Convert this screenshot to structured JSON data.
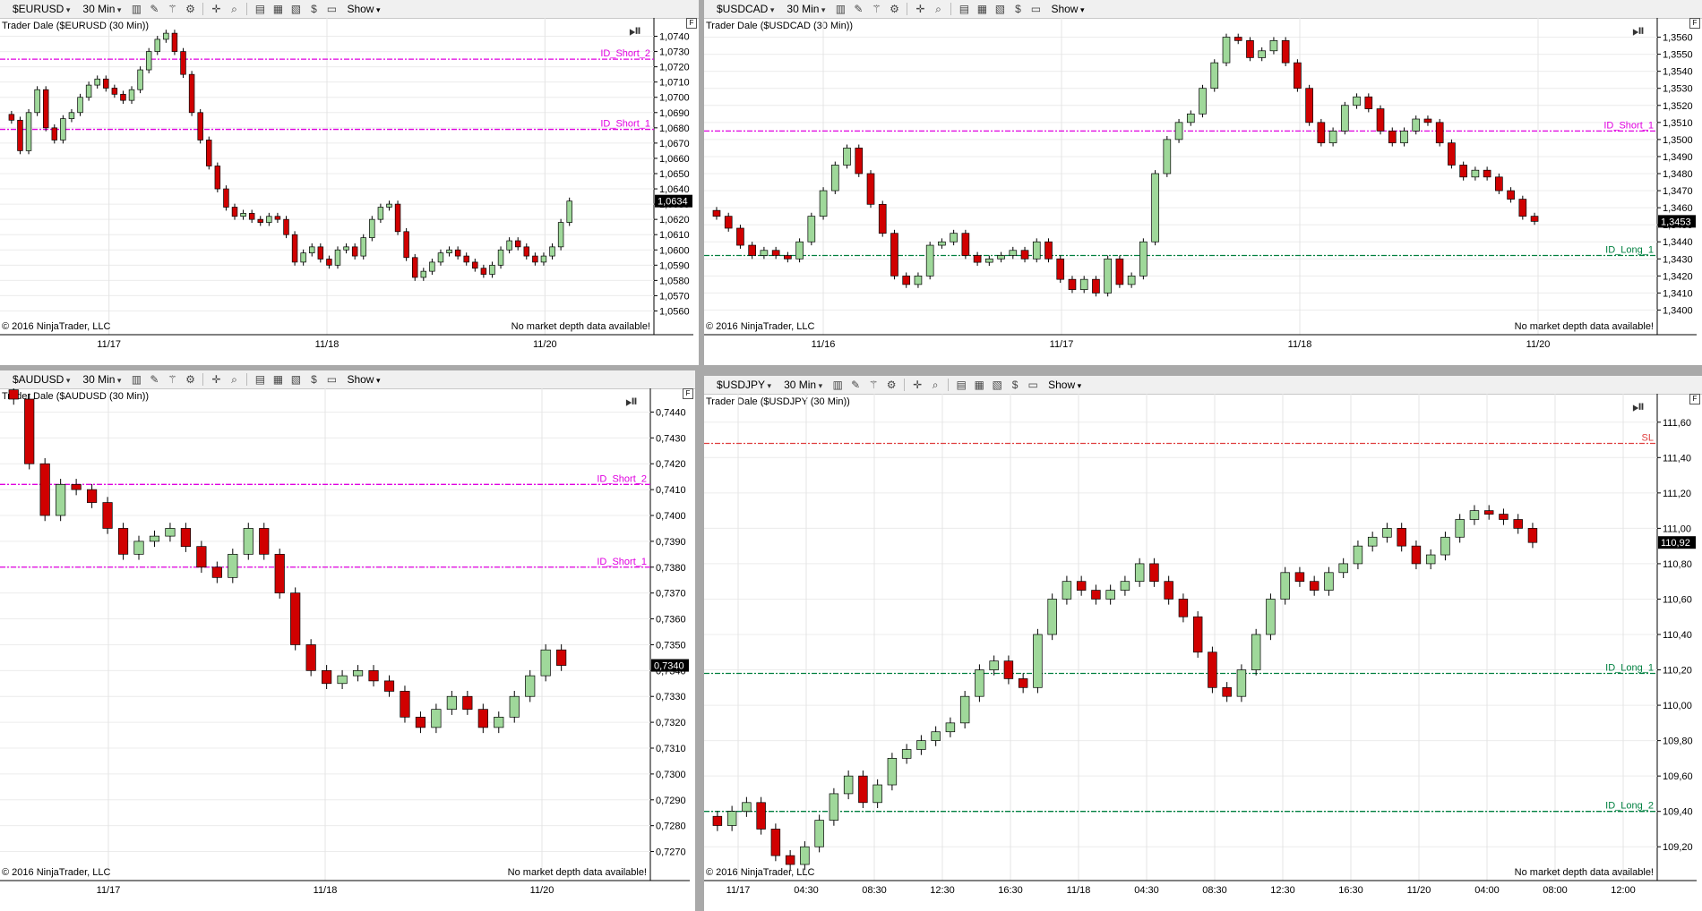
{
  "common": {
    "show_label": "Show",
    "copyright": "© 2016 NinjaTrader, LLC",
    "no_depth": "No market depth data available!",
    "f_label": "F"
  },
  "panels": [
    {
      "id": "eurusd",
      "symbol": "$EURUSD",
      "interval": "30 Min",
      "title": "Trader Dale  ($EURUSD (30 Min))",
      "price_label": "1,0634",
      "y_ticks": [
        "1,0740",
        "1,0730",
        "1,0720",
        "1,0710",
        "1,0700",
        "1,0690",
        "1,0680",
        "1,0670",
        "1,0660",
        "1,0650",
        "1,0640",
        "1,0630",
        "1,0620",
        "1,0610",
        "1,0600",
        "1,0590",
        "1,0580",
        "1,0570",
        "1,0560"
      ],
      "x_labels": [
        "11/17",
        "11/18",
        "11/20"
      ],
      "levels": [
        {
          "name": "ID_Short_2",
          "value": 1.0725,
          "color": "#e000e0"
        },
        {
          "name": "ID_Short_1",
          "value": 1.0679,
          "color": "#e000e0"
        }
      ],
      "candles": [
        1.0685,
        1.0665,
        1.069,
        1.0705,
        1.068,
        1.0672,
        1.0686,
        1.069,
        1.07,
        1.0708,
        1.0712,
        1.0706,
        1.0702,
        1.0698,
        1.0705,
        1.0718,
        1.073,
        1.0738,
        1.0742,
        1.073,
        1.0715,
        1.069,
        1.0672,
        1.0655,
        1.064,
        1.0628,
        1.0622,
        1.0624,
        1.062,
        1.0618,
        1.0622,
        1.062,
        1.061,
        1.0592,
        1.0598,
        1.0602,
        1.0594,
        1.059,
        1.06,
        1.0602,
        1.0596,
        1.0608,
        1.062,
        1.0628,
        1.063,
        1.0612,
        1.0595,
        1.0582,
        1.0586,
        1.0592,
        1.0598,
        1.06,
        1.0596,
        1.0592,
        1.0588,
        1.0584,
        1.059,
        1.06,
        1.0606,
        1.0602,
        1.0596,
        1.0592,
        1.0596,
        1.0602,
        1.0618,
        1.0632
      ]
    },
    {
      "id": "usdcad",
      "symbol": "$USDCAD",
      "interval": "30 Min",
      "title": "Trader Dale  ($USDCAD (30 Min))",
      "price_label": "1,3453",
      "y_ticks": [
        "1,3560",
        "1,3550",
        "1,3540",
        "1,3530",
        "1,3520",
        "1,3510",
        "1,3500",
        "1,3490",
        "1,3480",
        "1,3470",
        "1,3460",
        "1,3450",
        "1,3440",
        "1,3430",
        "1,3420",
        "1,3410",
        "1,3400"
      ],
      "x_labels": [
        "11/16",
        "11/17",
        "11/18",
        "11/20"
      ],
      "levels": [
        {
          "name": "ID_Short_1",
          "value": 1.3505,
          "color": "#e000e0"
        },
        {
          "name": "ID_Long_1",
          "value": 1.3432,
          "color": "#008040"
        }
      ],
      "candles": [
        1.3455,
        1.3448,
        1.3438,
        1.3432,
        1.3435,
        1.3432,
        1.343,
        1.344,
        1.3455,
        1.347,
        1.3485,
        1.3495,
        1.348,
        1.3462,
        1.3445,
        1.342,
        1.3415,
        1.342,
        1.3438,
        1.344,
        1.3445,
        1.3432,
        1.3428,
        1.343,
        1.3432,
        1.3435,
        1.343,
        1.344,
        1.343,
        1.3418,
        1.3412,
        1.3418,
        1.341,
        1.343,
        1.3415,
        1.342,
        1.344,
        1.348,
        1.35,
        1.351,
        1.3515,
        1.353,
        1.3545,
        1.356,
        1.3558,
        1.3548,
        1.3552,
        1.3558,
        1.3545,
        1.353,
        1.351,
        1.3498,
        1.3505,
        1.352,
        1.3525,
        1.3518,
        1.3505,
        1.3498,
        1.3505,
        1.3512,
        1.351,
        1.3498,
        1.3485,
        1.3478,
        1.3482,
        1.3478,
        1.347,
        1.3465,
        1.3455,
        1.3452
      ]
    },
    {
      "id": "audusd",
      "symbol": "$AUDUSD",
      "interval": "30 Min",
      "title": "Trader Dale  ($AUDUSD (30 Min))",
      "price_label": "0,7340",
      "y_ticks": [
        "0,7440",
        "0,7430",
        "0,7420",
        "0,7410",
        "0,7400",
        "0,7390",
        "0,7380",
        "0,7370",
        "0,7360",
        "0,7350",
        "0,7340",
        "0,7330",
        "0,7320",
        "0,7310",
        "0,7300",
        "0,7290",
        "0,7280",
        "0,7270"
      ],
      "x_labels": [
        "11/17",
        "11/18",
        "11/20"
      ],
      "levels": [
        {
          "name": "ID_Short_2",
          "value": 0.7412,
          "color": "#e000e0"
        },
        {
          "name": "ID_Short_1",
          "value": 0.738,
          "color": "#e000e0"
        }
      ],
      "candles": [
        0.7445,
        0.742,
        0.74,
        0.7412,
        0.741,
        0.7405,
        0.7395,
        0.7385,
        0.739,
        0.7392,
        0.7395,
        0.7388,
        0.738,
        0.7376,
        0.7385,
        0.7395,
        0.7385,
        0.737,
        0.735,
        0.734,
        0.7335,
        0.7338,
        0.734,
        0.7336,
        0.7332,
        0.7322,
        0.7318,
        0.7325,
        0.733,
        0.7325,
        0.7318,
        0.7322,
        0.733,
        0.7338,
        0.7348,
        0.7342
      ]
    },
    {
      "id": "usdjpy",
      "symbol": "$USDJPY",
      "interval": "30 Min",
      "title": "Trader Dale  ($USDJPY (30 Min))",
      "price_label": "110,92",
      "y_ticks": [
        "111,60",
        "111,40",
        "111,20",
        "111,00",
        "110,80",
        "110,60",
        "110,40",
        "110,20",
        "110,00",
        "109,80",
        "109,60",
        "109,40",
        "109,20"
      ],
      "x_labels": [
        "11/17",
        "04:30",
        "08:30",
        "12:30",
        "16:30",
        "11/18",
        "04:30",
        "08:30",
        "12:30",
        "16:30",
        "11/20",
        "04:00",
        "08:00",
        "12:00"
      ],
      "levels": [
        {
          "name": "SL",
          "value": 111.48,
          "color": "#e04040"
        },
        {
          "name": "ID_Long_1",
          "value": 110.18,
          "color": "#008040"
        },
        {
          "name": "ID_Long_2",
          "value": 109.4,
          "color": "#008040"
        }
      ],
      "candles": [
        109.32,
        109.4,
        109.45,
        109.3,
        109.15,
        109.1,
        109.2,
        109.35,
        109.5,
        109.6,
        109.45,
        109.55,
        109.7,
        109.75,
        109.8,
        109.85,
        109.9,
        110.05,
        110.2,
        110.25,
        110.15,
        110.1,
        110.4,
        110.6,
        110.7,
        110.65,
        110.6,
        110.65,
        110.7,
        110.8,
        110.7,
        110.6,
        110.5,
        110.3,
        110.1,
        110.05,
        110.2,
        110.4,
        110.6,
        110.75,
        110.7,
        110.65,
        110.75,
        110.8,
        110.9,
        110.95,
        111.0,
        110.9,
        110.8,
        110.85,
        110.95,
        111.05,
        111.1,
        111.08,
        111.05,
        111.0,
        110.92
      ]
    }
  ]
}
